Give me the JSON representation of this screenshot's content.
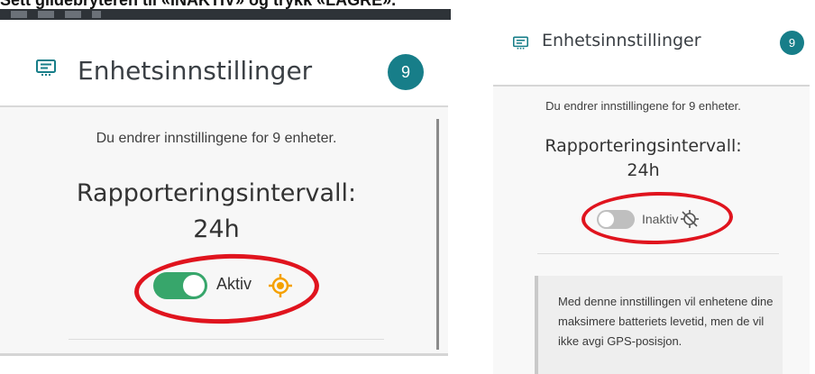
{
  "instruction": "Sett glidebryteren til «INAKTIV» og trykk «LAGRE».",
  "left_panel": {
    "title": "Enhetsinnstillinger",
    "badge": "9",
    "message": "Du endrer innstillingene for 9 enheter.",
    "interval_label": "Rapporteringsintervall:",
    "interval_value": "24h",
    "toggle_state": "on",
    "status_label": "Aktiv",
    "gps_icon": "gps-active-icon"
  },
  "right_panel": {
    "title": "Enhetsinnstillinger",
    "badge": "9",
    "message": "Du endrer innstillingene for 9 enheter.",
    "interval_label": "Rapporteringsintervall:",
    "interval_value": "24h",
    "toggle_state": "off",
    "status_label": "Inaktiv",
    "gps_icon": "gps-off-icon",
    "info_text": "Med denne innstillingen vil enhetene dine maksimere batteriets levetid, men de vil ikke avgi GPS-posisjon."
  },
  "colors": {
    "badge": "#177e89",
    "toggle_on": "#37a66b",
    "toggle_off": "#bfbfbf",
    "highlight": "#e0141e",
    "gps_active": "#f5a100"
  }
}
